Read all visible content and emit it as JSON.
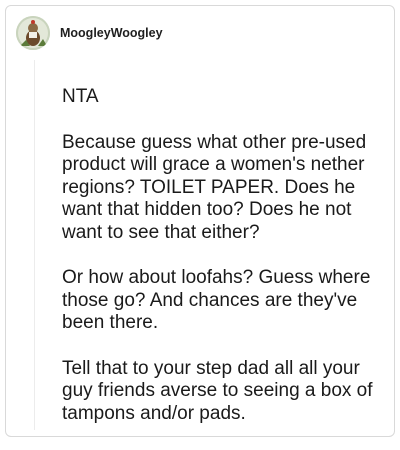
{
  "post": {
    "username": "MoogleyWoogley",
    "avatar_icon": "avatar-icon",
    "paragraphs": [
      "NTA",
      "Because guess what other pre-used product will grace a women's nether regions? TOILET PAPER. Does he want that hidden too? Does he not want to see that either?",
      "Or how about loofahs? Guess where those go? And chances are they've been there.",
      "Tell that to your step dad all all your guy friends averse to seeing a box of tampons and/or pads."
    ]
  }
}
